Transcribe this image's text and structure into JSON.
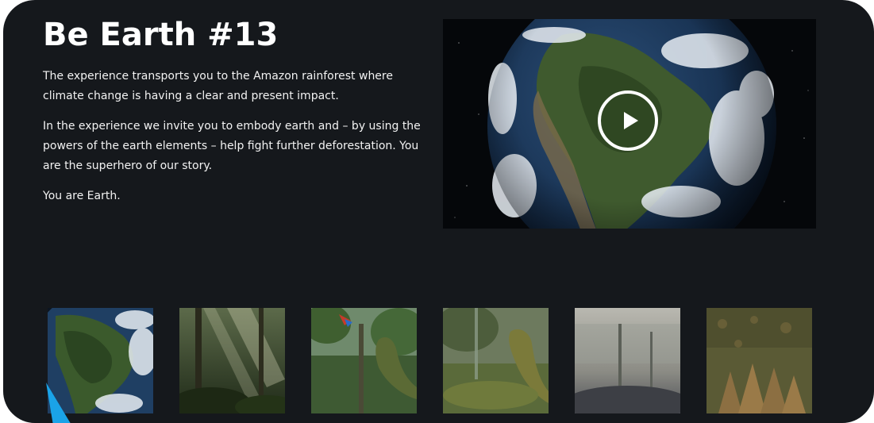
{
  "page": {
    "title": "Be Earth #13",
    "paragraphs": [
      "The experience transports you to the Amazon rainforest where climate change is having a clear and present impact.",
      "In the experience we invite you to embody earth and – by using the powers of the earth elements – help fight further deforestation. You are the superhero of our story.",
      "You are Earth."
    ]
  },
  "video": {
    "thumbnail": "earth-from-space-south-america",
    "icon": "play-icon"
  },
  "gallery": {
    "thumbnails": [
      "earth-south-america",
      "rainforest-sunbeams",
      "macaw-and-tree-hand",
      "forest-tree-hand",
      "foggy-deforested-land",
      "root-hands-on-ground"
    ]
  },
  "colors": {
    "background": "#15181c",
    "text": "#ffffff",
    "cursor": "#1aa3e8"
  }
}
